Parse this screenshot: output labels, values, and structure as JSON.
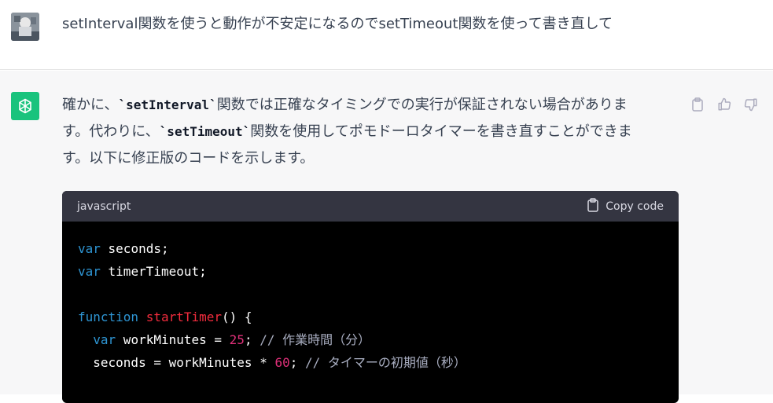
{
  "user": {
    "message": "setInterval関数を使うと動作が不安定になるのでsetTimeout関数を使って書き直して"
  },
  "assistant": {
    "para": {
      "p1": "確かに、",
      "c1": "`setInterval`",
      "p2": "関数では正確なタイミングでの実行が保証されない場合がありま",
      "p3": "す。代わりに、",
      "c2": "`setTimeout`",
      "p4": "関数を使用してポモドーロタイマーを書き直すことができま",
      "p5": "す。以下に修正版のコードを示します。"
    }
  },
  "code_block": {
    "language": "javascript",
    "copy_label": "Copy code",
    "lines": {
      "l1": {
        "kw": "var",
        "rest": " seconds;"
      },
      "l2": {
        "kw": "var",
        "rest": " timerTimeout;"
      },
      "l4": {
        "kw": "function",
        "fn": " startTimer",
        "rest": "() {"
      },
      "l5": {
        "indent": "  ",
        "kw": "var",
        "rest": " workMinutes = ",
        "num": "25",
        "rest2": "; ",
        "cm": "// 作業時間（分）"
      },
      "l6": {
        "indent": "  ",
        "rest": "seconds = workMinutes * ",
        "num": "60",
        "rest2": "; ",
        "cm": "// タイマーの初期値（秒）"
      }
    }
  },
  "icons": {
    "avatar": "user-avatar",
    "logo": "chatgpt-logo-icon",
    "copy": "clipboard-icon",
    "like": "thumbs-up-icon",
    "dislike": "thumbs-down-icon"
  },
  "colors": {
    "brand": "#19c37d",
    "code_header_bg": "#343541",
    "code_bg": "#000000",
    "assistant_bg": "#f7f7f8",
    "keyword": "#2e95d3",
    "function": "#f22c3d",
    "number": "#df3079",
    "comment": "#a9aec1"
  }
}
